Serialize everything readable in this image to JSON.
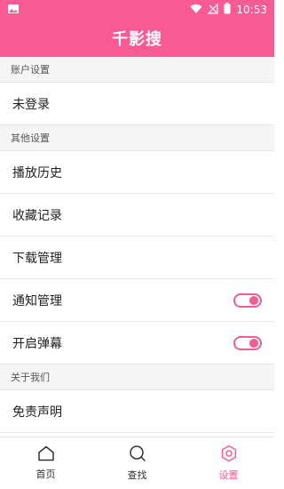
{
  "status_bar": {
    "time": "10:53",
    "icons": [
      "image-icon",
      "wifi-icon",
      "signal-off-icon",
      "battery-icon"
    ]
  },
  "app": {
    "title": "千影搜"
  },
  "sections": {
    "account": {
      "header": "账户设置",
      "login": "未登录"
    },
    "other": {
      "header": "其他设置",
      "history": "播放历史",
      "favorites": "收藏记录",
      "downloads": "下载管理",
      "notifications": "通知管理",
      "popup": "开启弹幕",
      "notifications_on": true,
      "popup_on": true
    },
    "about": {
      "header": "关于我们",
      "disclaimer": "免责声明"
    }
  },
  "bottom_nav": {
    "home": "首页",
    "search": "查找",
    "settings": "设置",
    "active": "settings"
  },
  "colors": {
    "accent": "#f85a93"
  }
}
